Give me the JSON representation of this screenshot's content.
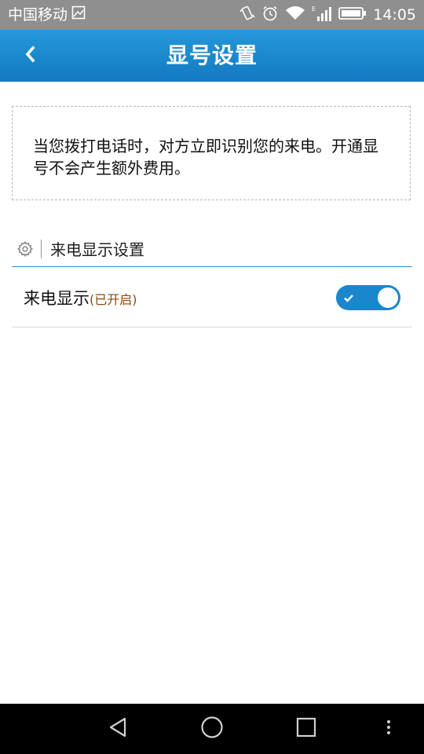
{
  "status_bar": {
    "carrier": "中国移动",
    "time": "14:05",
    "icons": [
      "image-icon",
      "vibrate-icon",
      "alarm-icon",
      "wifi-icon",
      "signal-icon",
      "battery-icon"
    ]
  },
  "header": {
    "title": "显号设置",
    "back_icon": "chevron-left-icon",
    "background": "#1a86cc"
  },
  "info": {
    "text": "当您拨打电话时，对方立即识别您的来电。开通显号不会产生额外费用。"
  },
  "section": {
    "icon": "gear-icon",
    "title": "来电显示设置"
  },
  "setting": {
    "label": "来电显示",
    "status": "(已开启)",
    "status_color": "#8a4a12",
    "toggle_on": true
  },
  "nav_bar": {
    "icons": [
      "back-triangle-icon",
      "home-circle-icon",
      "recents-square-icon",
      "more-dots-icon"
    ]
  }
}
